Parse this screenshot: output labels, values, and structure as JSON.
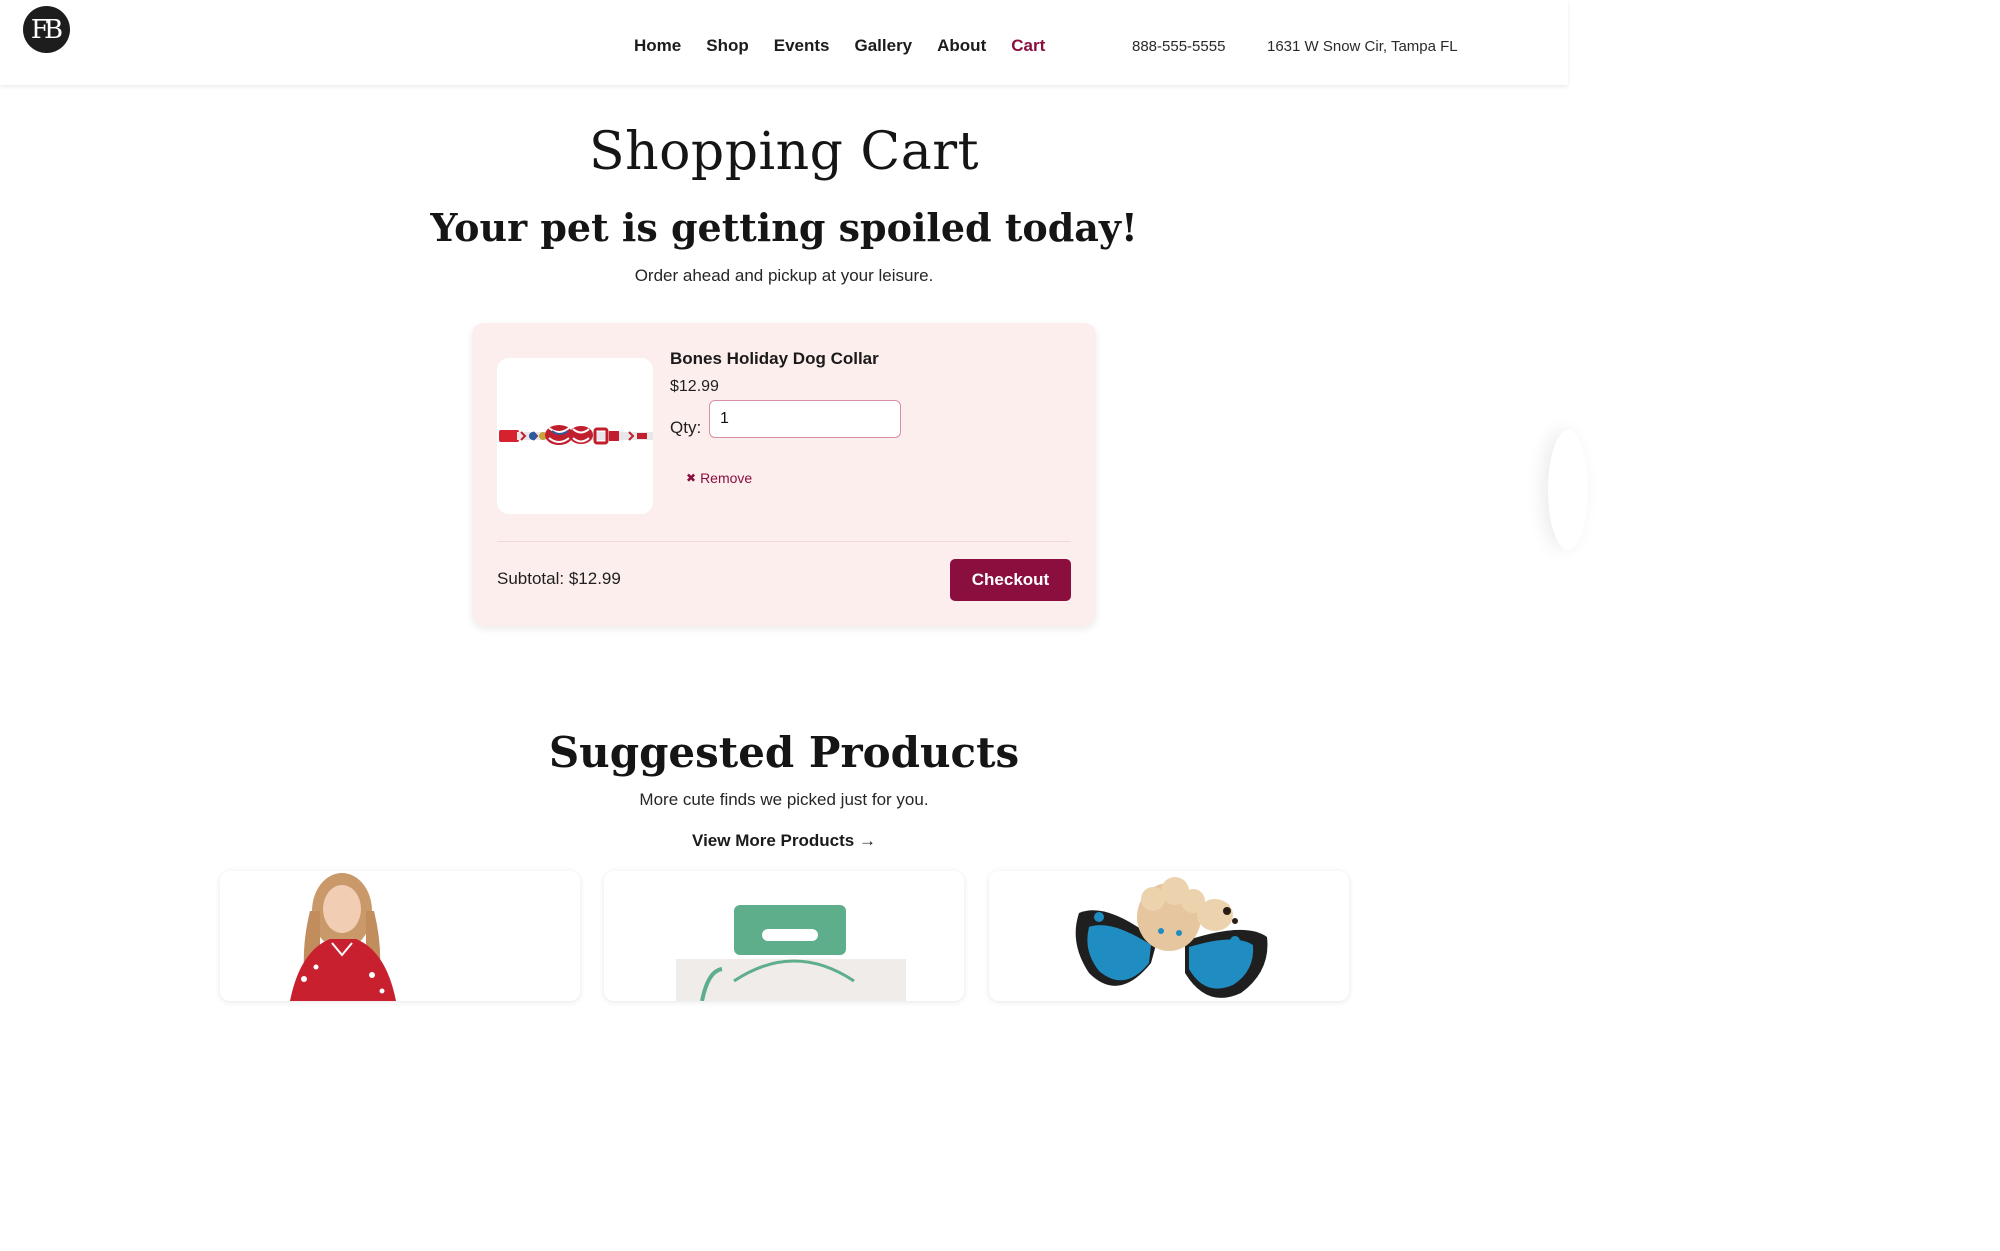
{
  "header": {
    "logo_text": "FB",
    "nav": [
      {
        "label": "Home",
        "active": false
      },
      {
        "label": "Shop",
        "active": false
      },
      {
        "label": "Events",
        "active": false
      },
      {
        "label": "Gallery",
        "active": false
      },
      {
        "label": "About",
        "active": false
      },
      {
        "label": "Cart",
        "active": true
      }
    ],
    "phone": "888-555-5555",
    "address": "1631 W Snow Cir, Tampa FL"
  },
  "page": {
    "title": "Shopping Cart",
    "subtitle": "Your pet is getting spoiled today!",
    "tagline": "Order ahead and pickup at your leisure."
  },
  "cart": {
    "items": [
      {
        "name": "Bones Holiday Dog Collar",
        "price": "$12.99",
        "qty_label": "Qty:",
        "qty_value": "1",
        "remove_icon": "✖",
        "remove_label": "Remove"
      }
    ],
    "subtotal_label": "Subtotal: $12.99",
    "checkout_label": "Checkout"
  },
  "suggested": {
    "title": "Suggested Products",
    "subtitle": "More cute finds we picked just for you.",
    "view_more_label": "View More Products →"
  },
  "colors": {
    "accent": "#8a0f3f",
    "card_bg": "#fdeeee"
  }
}
